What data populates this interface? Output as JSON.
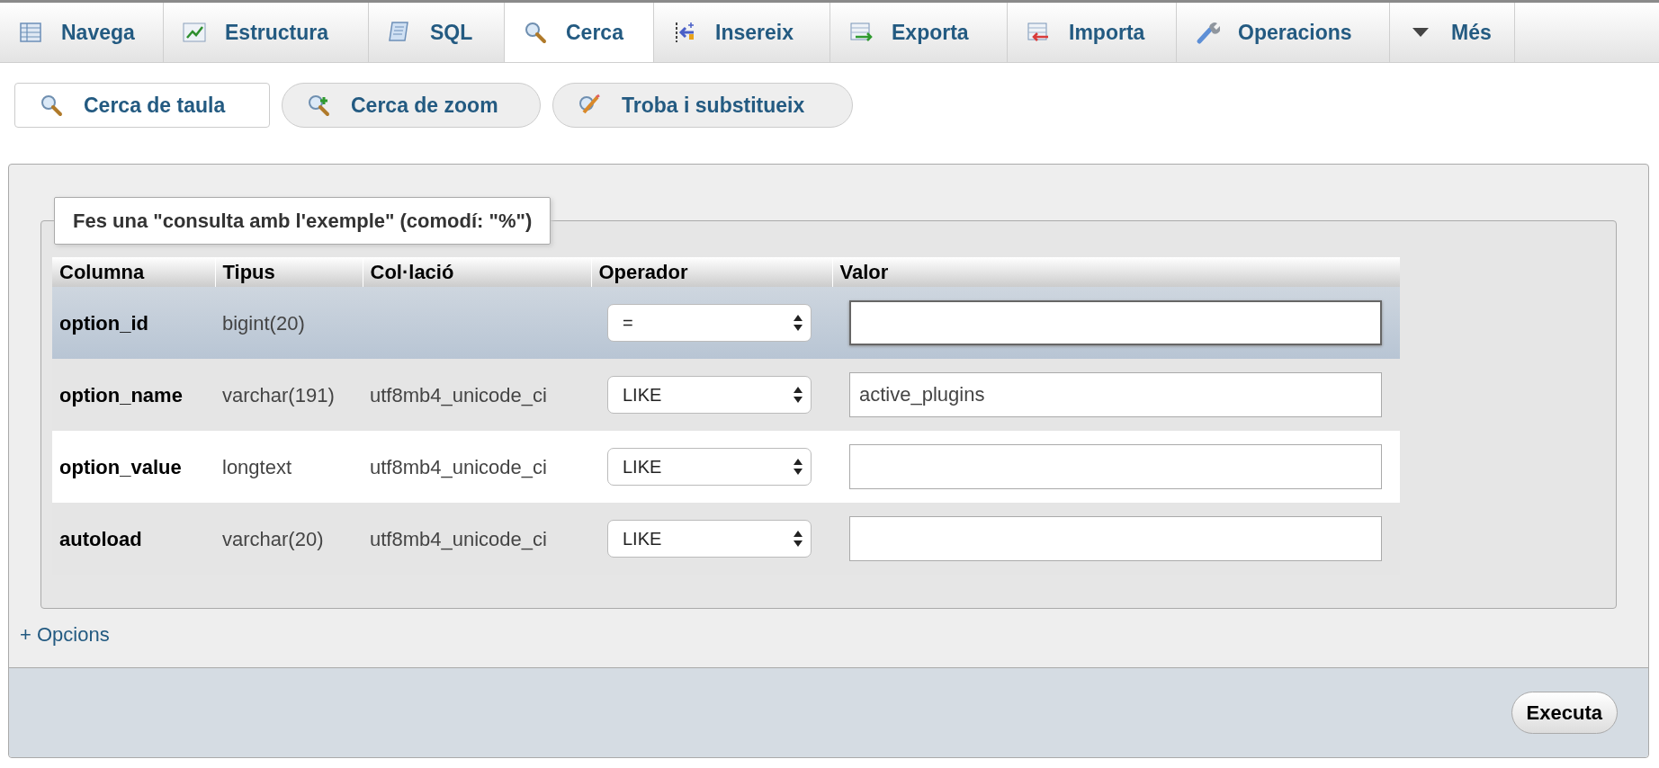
{
  "tabs": [
    {
      "label": "Navega",
      "kind": "table",
      "selected": false
    },
    {
      "label": "Estructura",
      "kind": "structure",
      "selected": false
    },
    {
      "label": "SQL",
      "kind": "scroll",
      "selected": false
    },
    {
      "label": "Cerca",
      "kind": "search",
      "selected": true
    },
    {
      "label": "Insereix",
      "kind": "insert",
      "selected": false
    },
    {
      "label": "Exporta",
      "kind": "export",
      "selected": false
    },
    {
      "label": "Importa",
      "kind": "import",
      "selected": false
    },
    {
      "label": "Operacions",
      "kind": "wrench",
      "selected": false
    },
    {
      "label": "Més",
      "kind": "caret",
      "selected": false
    }
  ],
  "subtabs": [
    {
      "label": "Cerca de taula",
      "kind": "search",
      "selected": true
    },
    {
      "label": "Cerca de zoom",
      "kind": "zoom",
      "selected": false
    },
    {
      "label": "Troba i substitueix",
      "kind": "replace",
      "selected": false
    }
  ],
  "form": {
    "legend": "Fes una \"consulta amb l'exemple\" (comodí: \"%\")",
    "table": {
      "columns": [
        "Columna",
        "Tipus",
        "Col·lació",
        "Operador",
        "Valor"
      ],
      "rows": [
        {
          "column": "option_id",
          "type": "bigint(20)",
          "operator": "=",
          "value": "",
          "highlighted": true,
          "focused": true
        },
        {
          "column": "option_name",
          "type": "varchar(191)",
          "collation": "utf8mb4_unicode_ci",
          "operator": "LIKE",
          "value": "active_plugins",
          "highlighted": false,
          "focused": false
        },
        {
          "column": "option_value",
          "type": "longtext",
          "collation": "utf8mb4_unicode_ci",
          "operator": "LIKE",
          "value": "",
          "highlighted": false,
          "focused": false
        },
        {
          "column": "autoload",
          "type": "varchar(20)",
          "collation": "utf8mb4_unicode_ci",
          "operator": "LIKE",
          "value": "",
          "highlighted": false,
          "focused": false
        }
      ]
    },
    "options_link": "+ Opcions"
  },
  "footer": {
    "button": "Executa"
  }
}
